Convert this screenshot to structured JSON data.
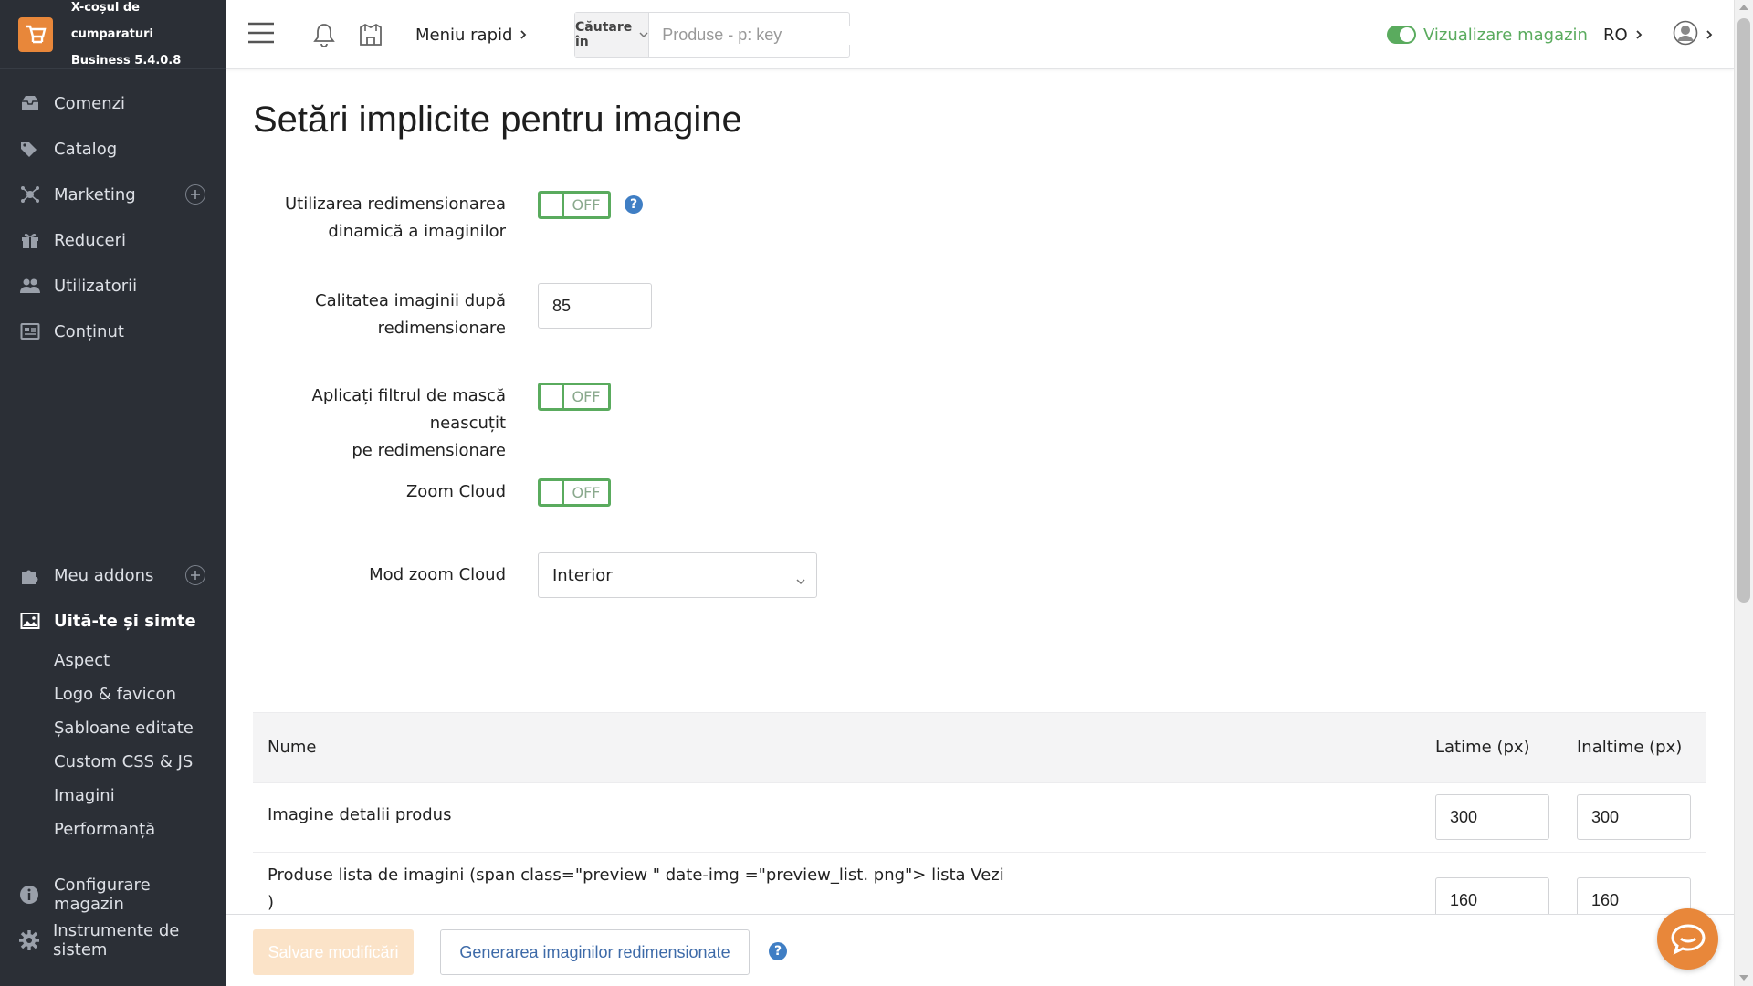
{
  "brand": {
    "name": "X-coșul de cumparaturi",
    "version": "Business 5.4.0.8"
  },
  "sidebar": {
    "items": [
      {
        "label": "Comenzi",
        "icon": "orders-icon"
      },
      {
        "label": "Catalog",
        "icon": "tags-icon"
      },
      {
        "label": "Marketing",
        "icon": "marketing-icon"
      },
      {
        "label": "Reduceri",
        "icon": "gift-icon"
      },
      {
        "label": "Utilizatorii",
        "icon": "users-icon"
      },
      {
        "label": "Conținut",
        "icon": "content-icon"
      }
    ],
    "lower": {
      "addons": "Meu addons",
      "look": "Uită-te și simte",
      "sub_items": [
        "Aspect",
        "Logo & favicon",
        "Șabloane editate",
        "Custom CSS & JS",
        "Imagini",
        "Performanță"
      ]
    },
    "bottom": [
      {
        "label": "Configurare magazin",
        "icon": "info-icon"
      },
      {
        "label": "Instrumente de sistem",
        "icon": "gear-icon"
      }
    ]
  },
  "topbar": {
    "quick_menu": "Meniu rapid",
    "search_scope": "Căutare în",
    "search_placeholder": "Produse - p: key",
    "view_store": "Vizualizare magazin",
    "language": "RO"
  },
  "page": {
    "title": "Setări implicite pentru imagine",
    "fields": {
      "dynamic_resize_label_1": "Utilizarea redimensionarea",
      "dynamic_resize_label_2": "dinamică a imaginilor",
      "dynamic_resize_state": "OFF",
      "quality_label_1": "Calitatea imaginii după",
      "quality_label_2": "redimensionare",
      "quality_value": "85",
      "unsharp_label_1": "Aplicați filtrul de mască neascuțit",
      "unsharp_label_2": "pe redimensionare",
      "unsharp_state": "OFF",
      "zoom_cloud_label": "Zoom Cloud",
      "zoom_cloud_state": "OFF",
      "zoom_mode_label": "Mod zoom Cloud",
      "zoom_mode_value": "Interior"
    },
    "help_glyph": "?"
  },
  "table": {
    "headers": {
      "name": "Nume",
      "width": "Latime (px)",
      "height": "Inaltime (px)"
    },
    "rows": [
      {
        "name_1": "Imagine detalii produs",
        "name_2": "",
        "width": "300",
        "height": "300"
      },
      {
        "name_1": "Produse lista de imagini (span class=\"preview \" date-img =\"preview_list. png\"> lista Vezi",
        "name_2": ")",
        "width": "160",
        "height": "160"
      }
    ]
  },
  "actions": {
    "save": "Salvare modificări",
    "generate": "Generarea imaginilor redimensionate"
  },
  "colors": {
    "sidebar_bg": "#2b2f36",
    "accent_orange": "#e8873a",
    "toggle_green": "#5aab5e",
    "link_blue": "#3d6aa8"
  }
}
